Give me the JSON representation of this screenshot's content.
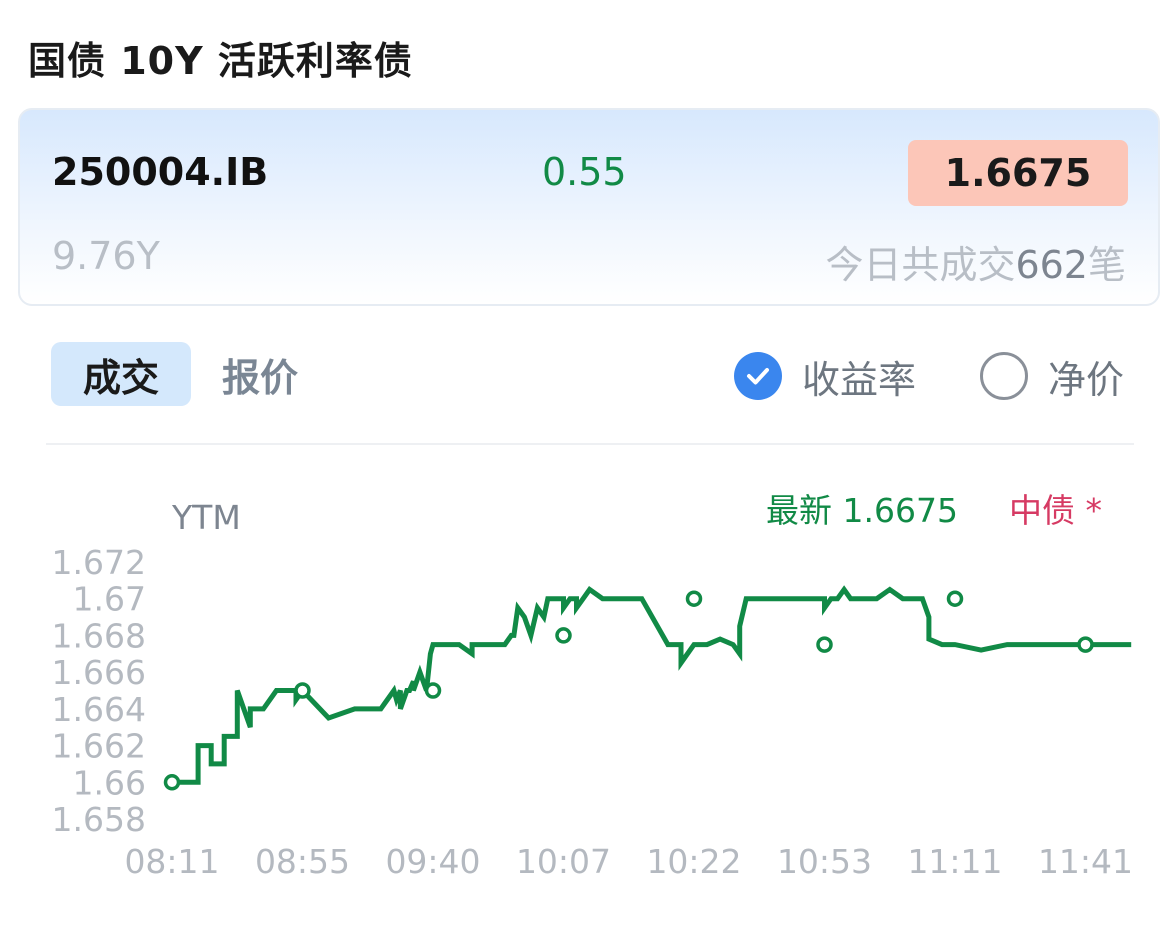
{
  "page": {
    "title": "国债 10Y 活跃利率债"
  },
  "bond": {
    "code": "250004.IB",
    "change": "0.55",
    "price": "1.6675",
    "term": "9.76Y",
    "trades_prefix": "今日共成交",
    "trades_count": "662",
    "trades_suffix": "笔"
  },
  "tabs": [
    {
      "label": "成交",
      "active": true
    },
    {
      "label": "报价",
      "active": false
    }
  ],
  "options": [
    {
      "label": "收益率",
      "checked": true
    },
    {
      "label": "净价",
      "checked": false
    }
  ],
  "colors": {
    "line": "#118a46",
    "accent_blue": "#3a86ee",
    "price_bg": "#fcc6b8",
    "zhongzhai": "#d63a63"
  },
  "chart_data": {
    "type": "line",
    "ylabel": "YTM",
    "latest_label": "最新 1.6675",
    "legend_label": "中债 *",
    "ylim": [
      1.658,
      1.672
    ],
    "yticks": [
      "1.672",
      "1.67",
      "1.668",
      "1.666",
      "1.664",
      "1.662",
      "1.66",
      "1.658"
    ],
    "xtick_labels": [
      "08:11",
      "08:55",
      "09:40",
      "10:07",
      "10:22",
      "10:53",
      "11:11",
      "11:41"
    ],
    "series": [
      {
        "x": [
          0,
          0.1,
          0.2,
          0.2,
          0.3,
          0.3,
          0.4,
          0.4,
          0.5,
          0.5,
          0.6,
          0.6,
          0.7,
          0.8,
          0.8,
          0.9,
          0.95,
          0.95,
          1.0,
          1.0,
          1.2,
          1.4,
          1.6,
          1.7,
          1.72,
          1.75,
          1.75,
          1.8,
          1.82,
          1.85,
          1.85,
          1.9,
          1.95,
          1.98,
          2.0,
          2.2,
          2.3,
          2.3,
          2.35,
          2.4,
          2.45,
          2.5,
          2.55,
          2.6,
          2.62,
          2.65,
          2.7,
          2.75,
          2.8,
          2.85,
          2.88,
          2.9,
          3.0,
          3.0,
          3.05,
          3.1,
          3.1,
          3.15,
          3.2,
          3.3,
          3.4,
          3.5,
          3.6,
          3.8,
          3.9,
          3.9,
          4.0,
          4.1,
          4.2,
          4.3,
          4.35,
          4.35,
          4.4,
          4.45,
          4.5,
          4.6,
          4.8,
          5.0,
          5.0,
          5.05,
          5.1,
          5.15,
          5.2,
          5.3,
          5.4,
          5.5,
          5.6,
          5.7,
          5.75,
          5.8,
          5.8,
          5.9,
          6.0,
          6.2,
          6.4,
          6.5,
          6.6,
          6.8,
          7.0,
          7.0,
          7.05,
          7.1,
          7.15,
          7.2,
          7.3,
          7.35
        ],
        "values": [
          1.66,
          1.66,
          1.66,
          1.662,
          1.662,
          1.661,
          1.661,
          1.6625,
          1.6625,
          1.665,
          1.663,
          1.664,
          1.664,
          1.665,
          1.665,
          1.665,
          1.665,
          1.6645,
          1.665,
          1.665,
          1.6635,
          1.664,
          1.664,
          1.665,
          1.6645,
          1.665,
          1.664,
          1.665,
          1.665,
          1.6655,
          1.665,
          1.666,
          1.665,
          1.667,
          1.6675,
          1.6675,
          1.667,
          1.6675,
          1.6675,
          1.6675,
          1.6675,
          1.6675,
          1.6675,
          1.668,
          1.668,
          1.6695,
          1.669,
          1.668,
          1.6695,
          1.669,
          1.67,
          1.67,
          1.67,
          1.6695,
          1.67,
          1.67,
          1.6695,
          1.67,
          1.6705,
          1.67,
          1.67,
          1.67,
          1.67,
          1.6675,
          1.6675,
          1.6665,
          1.6675,
          1.6675,
          1.6678,
          1.6675,
          1.667,
          1.6685,
          1.67,
          1.67,
          1.67,
          1.67,
          1.67,
          1.67,
          1.6695,
          1.67,
          1.67,
          1.6705,
          1.67,
          1.67,
          1.67,
          1.6705,
          1.67,
          1.67,
          1.67,
          1.669,
          1.6678,
          1.6675,
          1.6675,
          1.6672,
          1.6675,
          1.6675,
          1.6675,
          1.6675,
          1.6675,
          1.6675,
          1.6675,
          1.6675,
          1.6675,
          1.6675,
          1.6675,
          1.6675
        ],
        "markers": [
          {
            "x": 0,
            "y": 1.66
          },
          {
            "x": 1.0,
            "y": 1.665
          },
          {
            "x": 2.0,
            "y": 1.665
          },
          {
            "x": 3.0,
            "y": 1.668
          },
          {
            "x": 4.0,
            "y": 1.67
          },
          {
            "x": 5.0,
            "y": 1.6675
          },
          {
            "x": 6.0,
            "y": 1.67
          },
          {
            "x": 7.0,
            "y": 1.6675
          }
        ]
      }
    ]
  }
}
